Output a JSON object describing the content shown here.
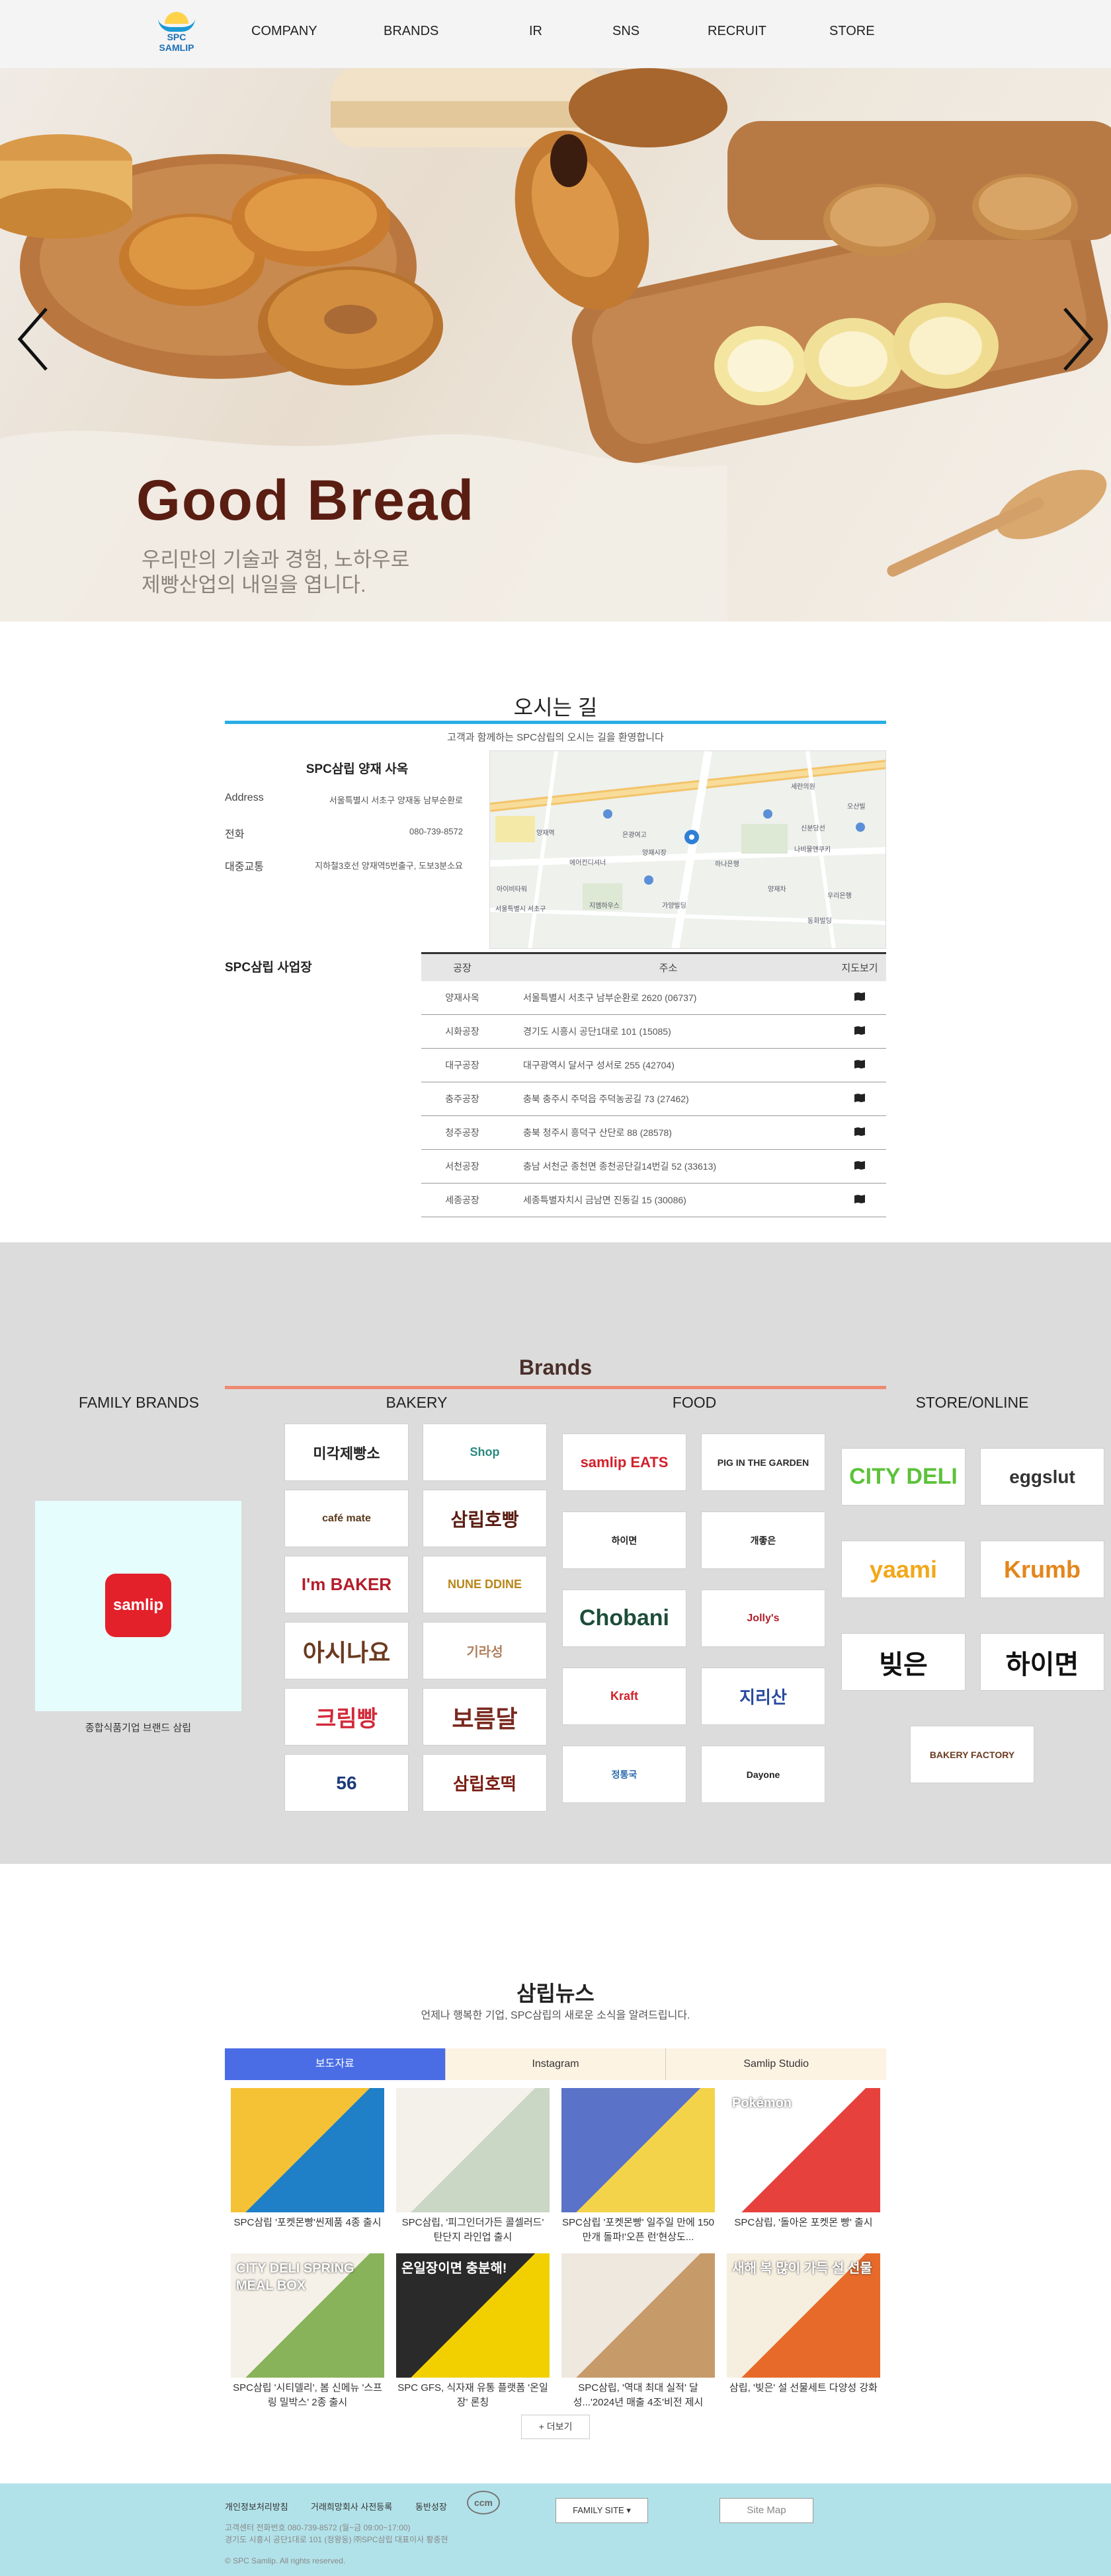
{
  "header": {
    "logo_line1": "SPC",
    "logo_line2": "SAMLIP",
    "nav": [
      "COMPANY",
      "BRANDS",
      "IR",
      "SNS",
      "RECRUIT",
      "STORE"
    ]
  },
  "hero": {
    "title": "Good Bread",
    "subtitle_line1": "우리만의 기술과 경험, 노하우로",
    "subtitle_line2": "제빵산업의 내일을 엽니다."
  },
  "directions": {
    "title": "오시는 길",
    "subtitle": "고객과 함께하는 SPC삼립의 오시는 길을 환영합니다",
    "hq": {
      "name": "SPC삼립 양재 사옥",
      "address_label": "Address",
      "address": "서울특별시 서초구 양재동 남부순환로",
      "phone_label": "전화",
      "phone": "080-739-8572",
      "transit_label": "대중교통",
      "transit": "지하철3호선 양재역5번출구, 도보3분소요"
    },
    "map_labels": [
      "서울특별시 서초구",
      "양재역",
      "은광여고",
      "세란의원",
      "오산빌",
      "신분당선",
      "나비물앤쿠키",
      "하나은행",
      "양재시장",
      "에어컨디셔너",
      "아이비타워",
      "지엠하우스",
      "가양빌딩",
      "양재차",
      "우리은행",
      "동화빌딩"
    ],
    "sites_label": "SPC삼립 사업장",
    "table_headers": [
      "공장",
      "주소",
      "지도보기"
    ],
    "sites": [
      {
        "name": "양재사옥",
        "address": "서울특별시 서초구 남부순환로 2620 (06737)"
      },
      {
        "name": "시화공장",
        "address": "경기도 시흥시 공단1대로 101 (15085)"
      },
      {
        "name": "대구공장",
        "address": "대구광역시 달서구 성서로 255 (42704)"
      },
      {
        "name": "충주공장",
        "address": "충북 충주시 주덕읍 주덕농공길 73 (27462)"
      },
      {
        "name": "청주공장",
        "address": "충북 청주시 흥덕구 산단로 88 (28578)"
      },
      {
        "name": "서천공장",
        "address": "충남 서천군 종천면 종천공단길14번길 52 (33613)"
      },
      {
        "name": "세종공장",
        "address": "세종특별자치시 금남면 진동길 15 (30086)"
      }
    ]
  },
  "brands": {
    "title": "Brands",
    "columns": [
      "FAMILY BRANDS",
      "BAKERY",
      "FOOD",
      "STORE/ONLINE"
    ],
    "family_logo": "samlip",
    "family_caption": "종합식품기업 브랜드 삼립",
    "bakery": [
      "미각제빵소",
      "Shop",
      "café mate",
      "삼립호빵",
      "I'm BAKER",
      "NUNE DDINE",
      "아시나요",
      "기라성",
      "크림빵",
      "보름달",
      "56",
      "삼립호떡"
    ],
    "food": [
      "samlip EATS",
      "PIG IN THE GARDEN",
      "하이면",
      "개좋은",
      "Chobani",
      "Jolly's",
      "Kraft",
      "지리산",
      "정통국",
      "Dayone"
    ],
    "store": [
      "CITY DELI",
      "eggslut",
      "yaami",
      "Krumb",
      "빚은",
      "하이면",
      "BAKERY FACTORY"
    ]
  },
  "news": {
    "title": "삼립뉴스",
    "subtitle": "언제나 행복한 기업, SPC삼립의 새로운 소식을 알려드립니다.",
    "tabs": [
      "보도자료",
      "Instagram",
      "Samlip Studio"
    ],
    "items": [
      {
        "caption": "SPC삼립 '포켓몬빵'씬제품 4종 출시",
        "thumb_label": ""
      },
      {
        "caption": "SPC삼립, '피그인더가든 콜셀러드' 탄단지 라인업 출시",
        "thumb_label": ""
      },
      {
        "caption": "SPC삼립 '포켓몬빵' 일주일 만에 150만개 돌파!'오픈 런'현상도...",
        "thumb_label": ""
      },
      {
        "caption": "SPC삼립, '돌아온 포켓몬 빵' 출시",
        "thumb_label": "Pokémon"
      },
      {
        "caption": "SPC삼립 '시티델리', 봄 신메뉴 '스프링 밀박스' 2종 출시",
        "thumb_label": "CITY DELI SPRING MEAL BOX"
      },
      {
        "caption": "SPC GFS, 식자재 유통 플랫폼 '온일장' 론칭",
        "thumb_label": "온일장이면 충분해!"
      },
      {
        "caption": "SPC삼립, '역대 최대 실적' 달성...'2024년 매출 4조'비전 제시",
        "thumb_label": ""
      },
      {
        "caption": "삼립, '빚은' 설 선물세트 다양성 강화",
        "thumb_label": "새해 복 많이 가득 설 선물"
      }
    ],
    "more": "+ 더보기"
  },
  "footer": {
    "links": [
      "개인정보처리방침",
      "거래희망회사 사전등록",
      "동반성장"
    ],
    "ccm": "ccm",
    "info_line1": "고객센터 전화번호 080-739-8572 (월~금 09:00~17:00)",
    "info_line2": "경기도 시흥시 공단1대로 101 (정왕동) ㈜SPC삼립 대표이사 황종현",
    "family_site": "FAMILY SITE",
    "sitemap": "Site Map",
    "copyright": "© SPC Samlip. All rights reserved."
  },
  "colors": {
    "header_bg": "#f4f4f4",
    "accent_blue": "#29aee6",
    "brands_line": "#ee8a72",
    "brands_bg": "#dcdcdc",
    "news_tab_active": "#4a6de5",
    "footer_bg": "#b2e2e9",
    "hero_title": "#5a1d12"
  }
}
